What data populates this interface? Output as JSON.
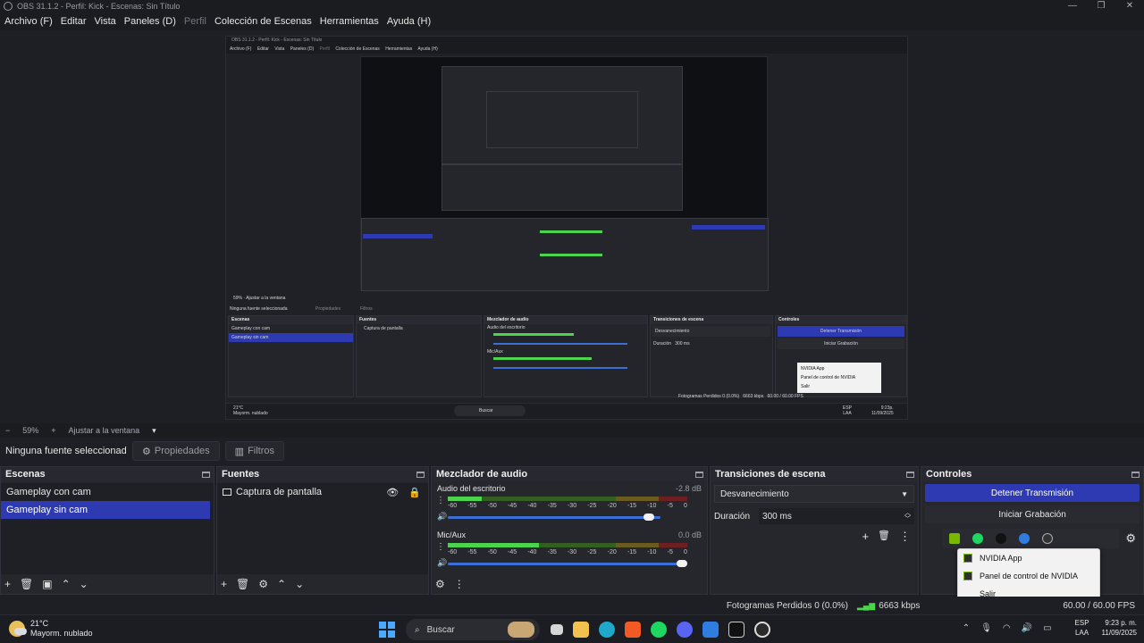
{
  "window": {
    "title": "OBS 31.1.2 - Perfil: Kick - Escenas: Sin Título",
    "controls": [
      "—",
      "❐",
      "✕"
    ]
  },
  "menu": [
    {
      "label": "Archivo (F)",
      "enabled": true
    },
    {
      "label": "Editar",
      "enabled": true
    },
    {
      "label": "Vista",
      "enabled": true
    },
    {
      "label": "Paneles (D)",
      "enabled": true
    },
    {
      "label": "Perfil",
      "enabled": false
    },
    {
      "label": "Colección de Escenas",
      "enabled": true
    },
    {
      "label": "Herramientas",
      "enabled": true
    },
    {
      "label": "Ayuda (H)",
      "enabled": true
    }
  ],
  "zoom": {
    "minus": "−",
    "value": "59%",
    "plus": "+",
    "fit_label": "Ajustar a la ventana",
    "dropdown": "▾"
  },
  "source_bar": {
    "no_source": "Ninguna fuente seleccionada",
    "properties": "Propiedades",
    "filters": "Filtros"
  },
  "scenes": {
    "title": "Escenas",
    "items": [
      {
        "label": "Gameplay con cam",
        "selected": false
      },
      {
        "label": "Gameplay sin cam",
        "selected": true
      }
    ],
    "footer": [
      "+",
      "🗑",
      "▣",
      "⌃",
      "⌄"
    ]
  },
  "sources": {
    "title": "Fuentes",
    "items": [
      {
        "label": "Captura de pantalla",
        "visible": true,
        "locked": true
      }
    ],
    "footer": [
      "+",
      "🗑",
      "⚙",
      "⌃",
      "⌄"
    ]
  },
  "mixer": {
    "title": "Mezclador de audio",
    "ticks": [
      "-60",
      "-55",
      "-50",
      "-45",
      "-40",
      "-35",
      "-30",
      "-25",
      "-20",
      "-15",
      "-10",
      "-5",
      "0"
    ],
    "channels": [
      {
        "name": "Audio del escritorio",
        "db": "-2.8 dB",
        "level": 0.14,
        "volume": 0.97
      },
      {
        "name": "Mic/Aux",
        "db": "0.0 dB",
        "level": 0.38,
        "volume": 1.0
      }
    ],
    "footer": [
      "⚙",
      "⋮"
    ]
  },
  "transitions": {
    "title": "Transiciones de escena",
    "selected": "Desvanecimiento",
    "duration_label": "Duración",
    "duration_value": "300 ms",
    "footer": [
      "+",
      "🗑",
      "⋮"
    ]
  },
  "controls": {
    "title": "Controles",
    "stop_stream": "Detener Transmisión",
    "start_record": "Iniciar Grabación"
  },
  "context_menu": {
    "items": [
      "NVIDIA App",
      "Panel de control de NVIDIA",
      "Salir"
    ]
  },
  "status": {
    "dropped": "Fotogramas Perdidos 0 (0.0%)",
    "bitrate": "6663 kbps",
    "fps": "60.00 / 60.00 FPS"
  },
  "taskbar": {
    "weather_temp": "21°C",
    "weather_desc": "Mayorm. nublado",
    "search": "Buscar",
    "lang_top": "ESP",
    "lang_bottom": "LAA",
    "time": "9:23 p. m.",
    "date": "11/09/2025"
  },
  "preview": {
    "title": "OBS 31.1.2 - Perfil: Kick - Escenas: Sin Título",
    "menu": [
      "Archivo (F)",
      "Editar",
      "Vista",
      "Paneles (D)",
      "Perfil",
      "Colección de Escenas",
      "Herramientas",
      "Ayuda (H)"
    ],
    "zoom": "59%",
    "fit": "Ajustar a la ventana",
    "no_source": "Ninguna fuente seleccionada",
    "properties": "Propiedades",
    "filters": "Filtros",
    "scenes": [
      "Gameplay con cam",
      "Gameplay sin cam"
    ],
    "source": "Captura de pantalla",
    "desk_audio": "Audio del escritorio",
    "mic": "Mic/Aux",
    "transition": "Desvanecimiento",
    "duration": "Duración",
    "duration_value": "300 ms",
    "stop": "Detener Transmisión",
    "record": "Iniciar Grabación",
    "nv1": "NVIDIA App",
    "nv2": "Panel de control de NVIDIA",
    "nv3": "Salir",
    "status": "Fotogramas Perdidos 0 (0.0%)",
    "kbps": "6663 kbps",
    "fps": "60.00 / 60.00 FPS",
    "temp": "21°C",
    "weather": "Mayorm. nublado",
    "search": "Buscar",
    "lang1": "ESP",
    "lang2": "LAA",
    "time": "9:23p.",
    "date": "11/09/2025",
    "panel_titles": [
      "Escenas",
      "Fuentes",
      "Mezclador de audio",
      "Transiciones de escena",
      "Controles"
    ]
  }
}
